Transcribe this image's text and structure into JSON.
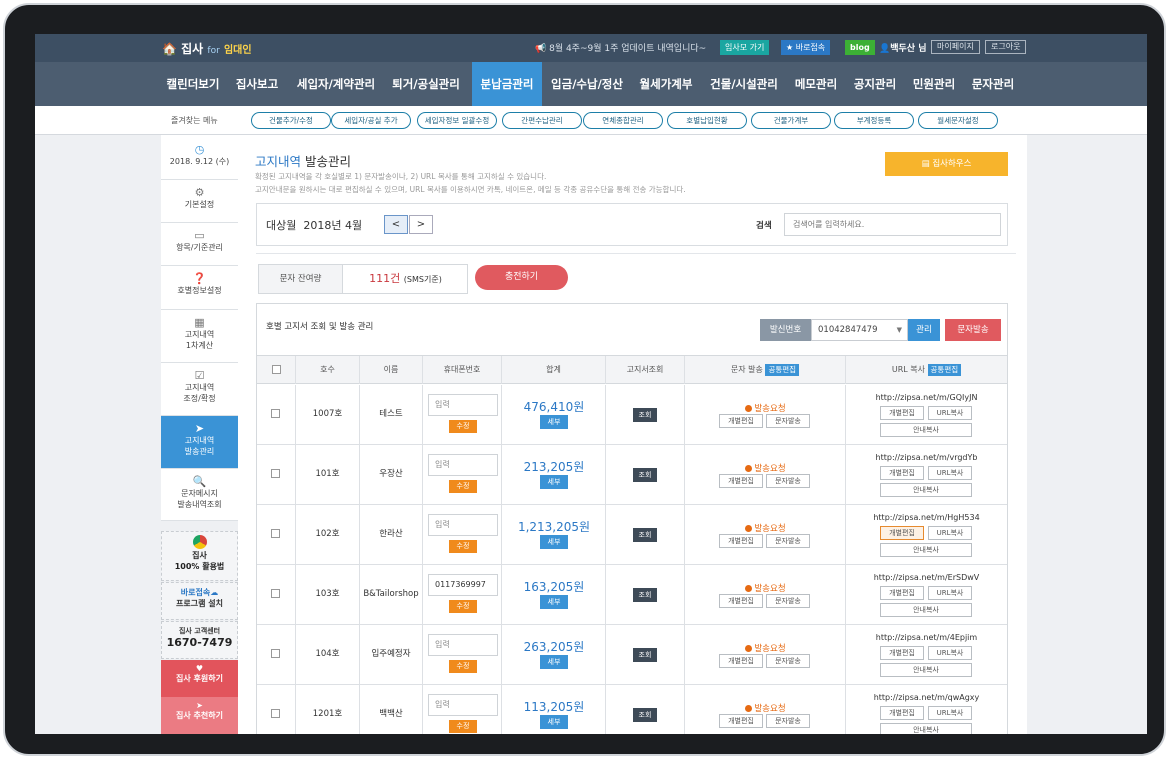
{
  "topbar": {
    "logo": "집사",
    "logo_for": "for",
    "logo_sub": "임대인",
    "notice": "8월 4주~9월 1주 업데이트 내역입니다~",
    "site_button": "임사모 가기",
    "quick_button": "★ 바로접속",
    "blog_button": "blog",
    "user_name": "백두산 님",
    "mypage_button": "마이페이지",
    "logout_button": "로그아웃"
  },
  "nav": {
    "items": [
      "캘린더보기",
      "집사보고",
      "세입자/계약관리",
      "퇴거/공실관리",
      "분납금관리",
      "입금/수납/정산",
      "월세가계부",
      "건물/시설관리",
      "메모관리",
      "공지관리",
      "민원관리",
      "문자관리"
    ],
    "active_index": 4
  },
  "quickmenu": {
    "label": "즐겨찾는 메뉴",
    "items": [
      "건물추가/수정",
      "세입자/공실 추가",
      "세입자정보 일괄수정",
      "간편수납관리",
      "연체종합관리",
      "호별납입현황",
      "건물가계부",
      "부계정등록",
      "월세문자설정"
    ]
  },
  "sidebar": {
    "date": "2018. 9.12 (수)",
    "items": [
      {
        "icon": "gear-icon",
        "label": "기본설정"
      },
      {
        "icon": "card-icon",
        "label": "항목/기준관리"
      },
      {
        "icon": "question-icon",
        "label": "호별정보설정"
      },
      {
        "icon": "calculator-icon",
        "label1": "고지내역",
        "label2": "1차계산"
      },
      {
        "icon": "check-icon",
        "label1": "고지내역",
        "label2": "조정/확정"
      },
      {
        "icon": "send-icon",
        "label1": "고지내역",
        "label2": "발송관리"
      },
      {
        "icon": "search-icon",
        "label1": "문자메시지",
        "label2": "발송내역조회"
      }
    ],
    "active_index": 5,
    "promo": {
      "chrome_line1": "집사",
      "chrome_line2": "100% 활용법",
      "quick_line1": "바로접속",
      "quick_line2": "프로그램 설치",
      "center_line1": "집사 고객센터",
      "center_phone": "1670-7479",
      "support_label": "집사 후원하기",
      "recommend_label": "집사 추천하기"
    }
  },
  "main": {
    "title_part1": "고지내역",
    "title_part2": "발송관리",
    "desc1": "확정된 고지내역을 각 호실별로 1) 문자발송이나, 2) URL 복사를 통해 고지하실 수 있습니다.",
    "desc2": "고지안내문을 원하시는 대로 편집하실 수 있으며, URL 복사를 이용하시면 카톡, 네이트온, 메일 등 각종 공유수단을 통해 전송 가능합니다.",
    "house_button": "집사하우스",
    "month_label": "대상월",
    "month_value": "2018년 4월",
    "prev_label": "<",
    "next_label": ">",
    "search_label": "검색",
    "search_placeholder": "검색어를 입력하세요.",
    "sms_label": "문자 잔여량",
    "sms_count": "111건",
    "sms_unit": "(SMS기준)",
    "charge_button": "충전하기",
    "table_title": "호별 고지서 조회 및 발송 관리",
    "sender_label": "발신번호",
    "sender_number": "01042847479",
    "manage_button": "관리",
    "send_sms_button": "문자발송",
    "headers": {
      "ho": "호수",
      "name": "이름",
      "phone": "휴대폰번호",
      "total": "합계",
      "view": "고지서조회",
      "sms": "문자 발송",
      "url": "URL 복사",
      "common_edit": "공통편집"
    },
    "row_labels": {
      "phone_placeholder": "입력",
      "edit": "수정",
      "detail": "세부",
      "view": "조회",
      "sms_request": "발송요청",
      "individual_edit": "개별편집",
      "sms_send": "문자발송",
      "url_copy": "URL복사",
      "guide_copy": "안내복사"
    },
    "rows": [
      {
        "ho": "1007호",
        "name": "테스트",
        "phone": "",
        "amount": "476,410원",
        "url": "http://zipsa.net/m/GQIyJN"
      },
      {
        "ho": "101호",
        "name": "우장산",
        "phone": "",
        "amount": "213,205원",
        "url": "http://zipsa.net/m/vrgdYb"
      },
      {
        "ho": "102호",
        "name": "한라산",
        "phone": "",
        "amount": "1,213,205원",
        "url": "http://zipsa.net/m/HgH534"
      },
      {
        "ho": "103호",
        "name": "B&Tailorshop",
        "phone": "0117369997",
        "amount": "163,205원",
        "url": "http://zipsa.net/m/ErSDwV"
      },
      {
        "ho": "104호",
        "name": "입주예정자",
        "phone": "",
        "amount": "263,205원",
        "url": "http://zipsa.net/m/4Epjim"
      },
      {
        "ho": "1201호",
        "name": "백백산",
        "phone": "",
        "amount": "113,205원",
        "url": "http://zipsa.net/m/qwAgxy"
      }
    ],
    "highlighted_row": 2
  },
  "colors": {
    "nav_bg": "#4c5d70",
    "accent_blue": "#3a93d6",
    "charge_red": "#e05a5f",
    "house_yellow": "#f7b42c",
    "sms_orange": "#e66a13"
  }
}
